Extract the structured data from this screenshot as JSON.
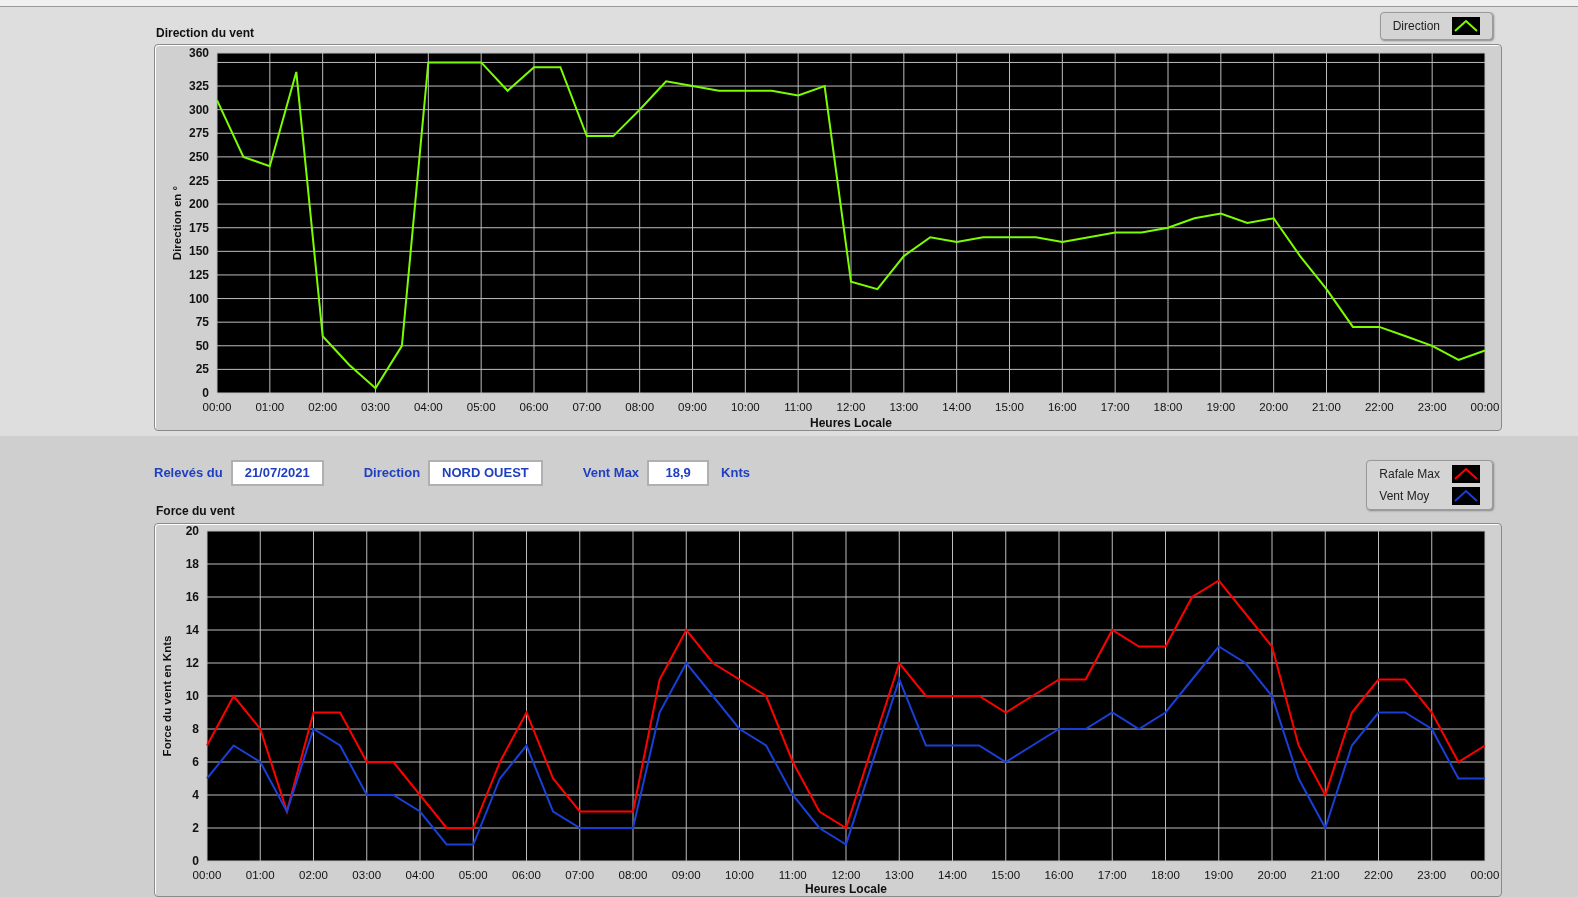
{
  "direction_panel": {
    "title": "Direction du vent",
    "chart_data": {
      "type": "line",
      "grid": true,
      "xlabel": "Heures Locale",
      "ylabel": "Direction en °",
      "ylim": [
        0,
        360
      ],
      "xlim": [
        0,
        24
      ],
      "x": [
        0,
        0.5,
        1,
        1.5,
        2,
        2.5,
        3,
        3.5,
        4,
        4.5,
        5,
        5.5,
        6,
        6.5,
        7,
        7.5,
        8,
        8.5,
        9,
        9.5,
        10,
        10.5,
        11,
        11.5,
        12,
        12.5,
        13,
        13.5,
        14,
        14.5,
        15,
        15.5,
        16,
        16.5,
        17,
        17.5,
        18,
        18.5,
        19,
        19.5,
        20,
        20.5,
        21,
        21.5,
        22,
        22.5,
        23,
        23.5,
        24
      ],
      "series": [
        {
          "name": "Direction",
          "color": "#7cfc00",
          "values": [
            310,
            250,
            240,
            340,
            60,
            30,
            5,
            50,
            350,
            350,
            350,
            320,
            345,
            345,
            272,
            272,
            300,
            330,
            325,
            320,
            320,
            320,
            315,
            325,
            118,
            110,
            145,
            165,
            160,
            165,
            165,
            165,
            160,
            165,
            170,
            170,
            175,
            185,
            190,
            180,
            185,
            145,
            110,
            70,
            70,
            60,
            50,
            35,
            45
          ]
        }
      ],
      "yticks": [
        0,
        25,
        50,
        75,
        100,
        125,
        150,
        175,
        200,
        225,
        250,
        275,
        300,
        325,
        360
      ],
      "xticks": [
        {
          "value": 0,
          "label": "00:00"
        },
        {
          "value": 1,
          "label": "01:00"
        },
        {
          "value": 2,
          "label": "02:00"
        },
        {
          "value": 3,
          "label": "03:00"
        },
        {
          "value": 4,
          "label": "04:00"
        },
        {
          "value": 5,
          "label": "05:00"
        },
        {
          "value": 6,
          "label": "06:00"
        },
        {
          "value": 7,
          "label": "07:00"
        },
        {
          "value": 8,
          "label": "08:00"
        },
        {
          "value": 9,
          "label": "09:00"
        },
        {
          "value": 10,
          "label": "10:00"
        },
        {
          "value": 11,
          "label": "11:00"
        },
        {
          "value": 12,
          "label": "12:00"
        },
        {
          "value": 13,
          "label": "13:00"
        },
        {
          "value": 14,
          "label": "14:00"
        },
        {
          "value": 15,
          "label": "15:00"
        },
        {
          "value": 16,
          "label": "16:00"
        },
        {
          "value": 17,
          "label": "17:00"
        },
        {
          "value": 18,
          "label": "18:00"
        },
        {
          "value": 19,
          "label": "19:00"
        },
        {
          "value": 20,
          "label": "20:00"
        },
        {
          "value": 21,
          "label": "21:00"
        },
        {
          "value": 22,
          "label": "22:00"
        },
        {
          "value": 23,
          "label": "23:00"
        },
        {
          "value": 24,
          "label": "00:00"
        }
      ]
    }
  },
  "fields": [
    {
      "label": "Relevés du",
      "value": "21/07/2021"
    },
    {
      "label": "Direction",
      "value": "NORD OUEST"
    },
    {
      "label": "Vent Max",
      "value": "18,9",
      "unit": "Knts"
    }
  ],
  "force_panel": {
    "title": "Force du vent",
    "chart_data": {
      "type": "line",
      "grid": true,
      "xlabel": "Heures Locale",
      "ylabel": "Force du vent en Knts",
      "ylim": [
        0,
        20
      ],
      "xlim": [
        0,
        24
      ],
      "x": [
        0,
        0.5,
        1,
        1.5,
        2,
        2.5,
        3,
        3.5,
        4,
        4.5,
        5,
        5.5,
        6,
        6.5,
        7,
        7.5,
        8,
        8.5,
        9,
        9.5,
        10,
        10.5,
        11,
        11.5,
        12,
        12.5,
        13,
        13.5,
        14,
        14.5,
        15,
        15.5,
        16,
        16.5,
        17,
        17.5,
        18,
        18.5,
        19,
        19.5,
        20,
        20.5,
        21,
        21.5,
        22,
        22.5,
        23,
        23.5,
        24
      ],
      "series": [
        {
          "name": "Rafale Max",
          "color": "#ff0000",
          "values": [
            7,
            10,
            8,
            3,
            9,
            9,
            6,
            6,
            4,
            2,
            2,
            6,
            9,
            5,
            3,
            3,
            3,
            11,
            14,
            12,
            11,
            10,
            6,
            3,
            2,
            7,
            12,
            10,
            10,
            10,
            9,
            10,
            11,
            11,
            14,
            13,
            13,
            16,
            17,
            15,
            13,
            7,
            4,
            9,
            11,
            11,
            9,
            6,
            7
          ]
        },
        {
          "name": "Vent Moy",
          "color": "#1a3fd6",
          "values": [
            5,
            7,
            6,
            3,
            8,
            7,
            4,
            4,
            3,
            1,
            1,
            5,
            7,
            3,
            2,
            2,
            2,
            9,
            12,
            10,
            8,
            7,
            4,
            2,
            1,
            6,
            11,
            7,
            7,
            7,
            6,
            7,
            8,
            8,
            9,
            8,
            9,
            11,
            13,
            12,
            10,
            5,
            2,
            7,
            9,
            9,
            8,
            5,
            5
          ]
        }
      ],
      "yticks": [
        0,
        2,
        4,
        6,
        8,
        10,
        12,
        14,
        16,
        18,
        20
      ],
      "xticks": [
        {
          "value": 0,
          "label": "00:00"
        },
        {
          "value": 1,
          "label": "01:00"
        },
        {
          "value": 2,
          "label": "02:00"
        },
        {
          "value": 3,
          "label": "03:00"
        },
        {
          "value": 4,
          "label": "04:00"
        },
        {
          "value": 5,
          "label": "05:00"
        },
        {
          "value": 6,
          "label": "06:00"
        },
        {
          "value": 7,
          "label": "07:00"
        },
        {
          "value": 8,
          "label": "08:00"
        },
        {
          "value": 9,
          "label": "09:00"
        },
        {
          "value": 10,
          "label": "10:00"
        },
        {
          "value": 11,
          "label": "11:00"
        },
        {
          "value": 12,
          "label": "12:00"
        },
        {
          "value": 13,
          "label": "13:00"
        },
        {
          "value": 14,
          "label": "14:00"
        },
        {
          "value": 15,
          "label": "15:00"
        },
        {
          "value": 16,
          "label": "16:00"
        },
        {
          "value": 17,
          "label": "17:00"
        },
        {
          "value": 18,
          "label": "18:00"
        },
        {
          "value": 19,
          "label": "19:00"
        },
        {
          "value": 20,
          "label": "20:00"
        },
        {
          "value": 21,
          "label": "21:00"
        },
        {
          "value": 22,
          "label": "22:00"
        },
        {
          "value": 23,
          "label": "23:00"
        },
        {
          "value": 24,
          "label": "00:00"
        }
      ]
    }
  }
}
